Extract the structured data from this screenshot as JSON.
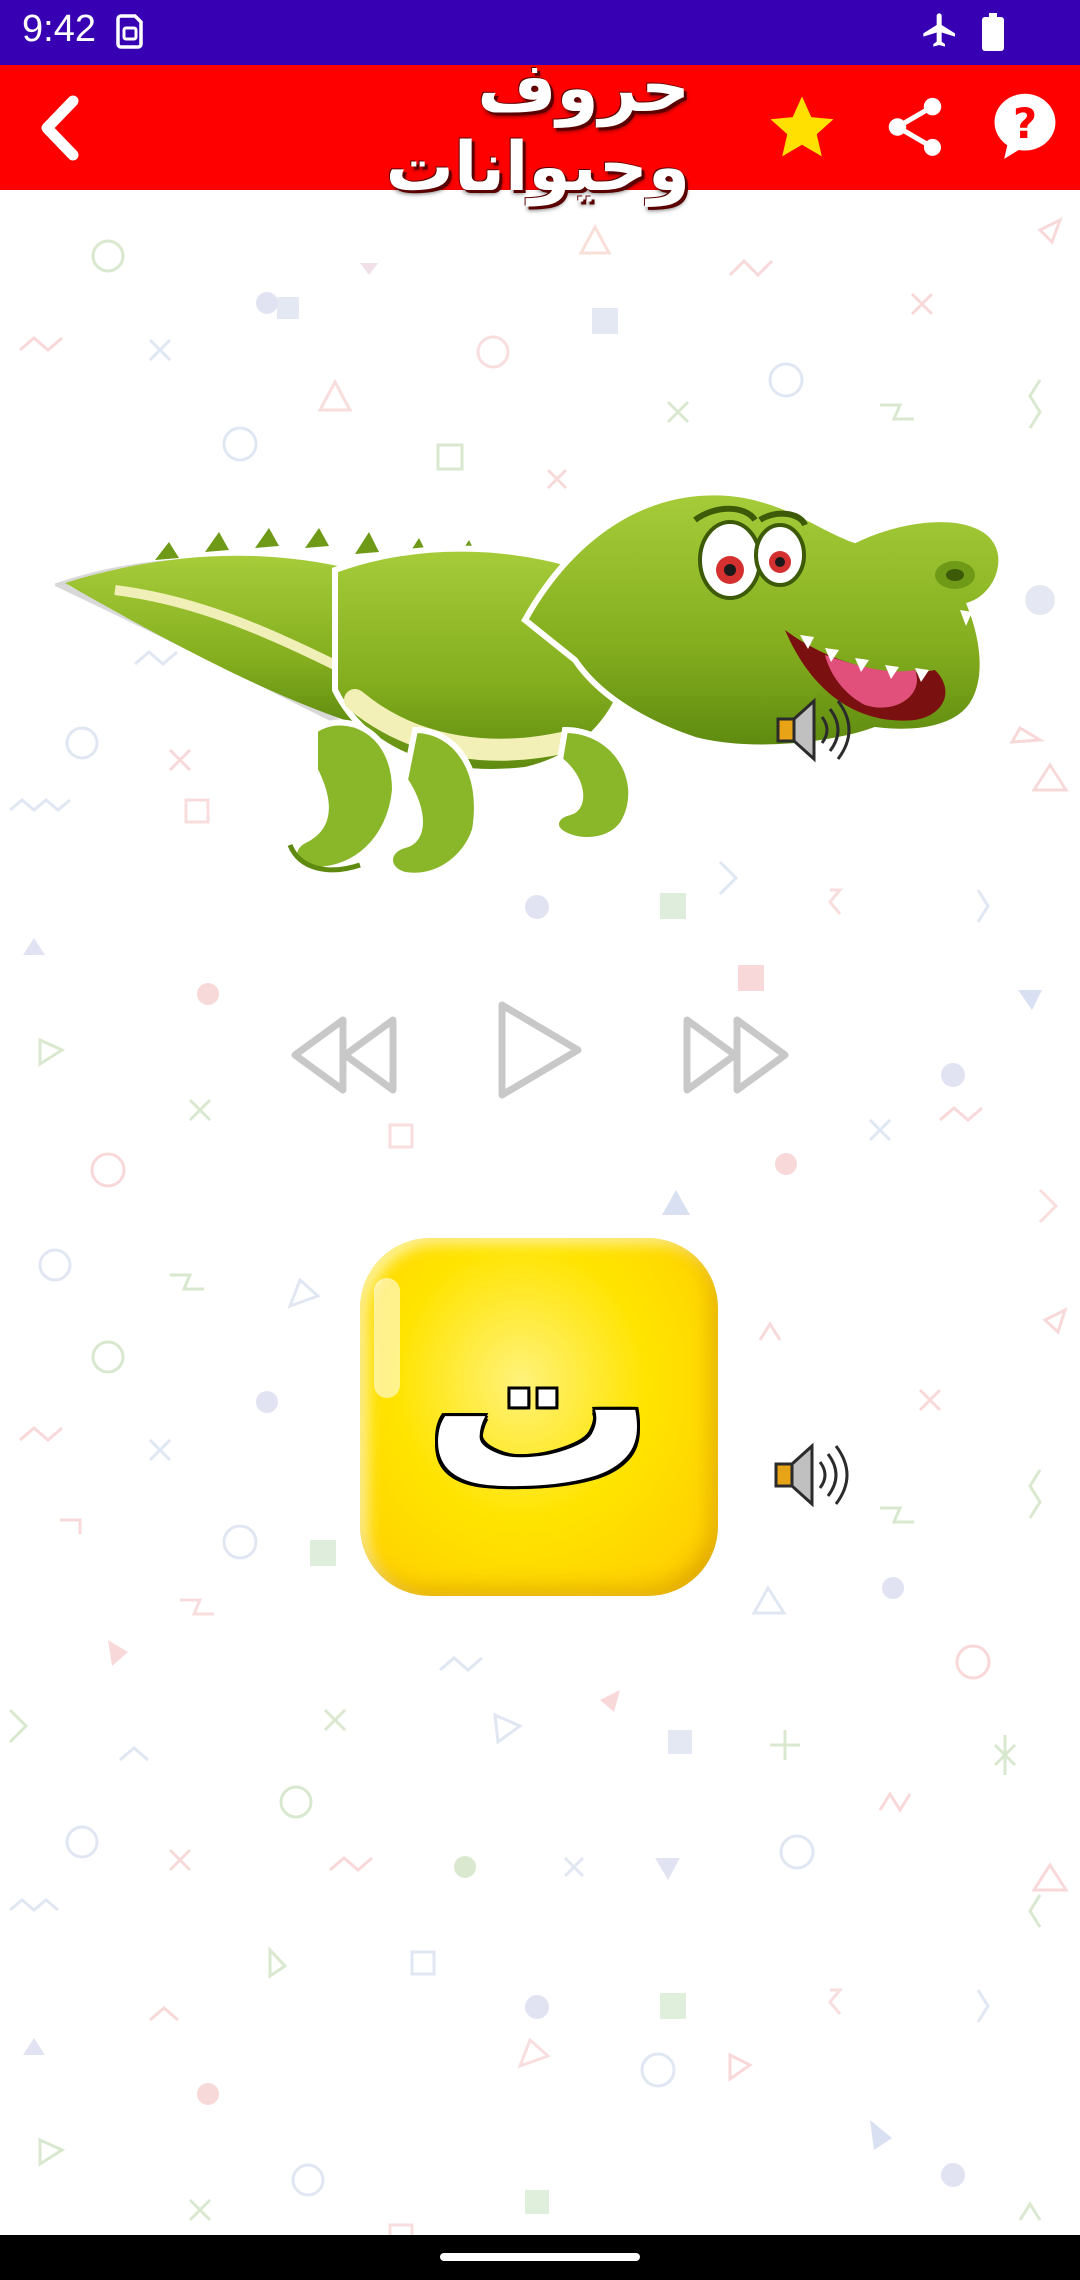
{
  "status_bar": {
    "time": "9:42",
    "icons": [
      "sim-icon",
      "airplane-mode-icon",
      "battery-icon"
    ]
  },
  "app_bar": {
    "title": "حروف وحيوانات",
    "background_color": "#ff0000",
    "actions": [
      "back-icon",
      "star-icon",
      "share-icon",
      "help-icon"
    ],
    "star_color": "#ffe000"
  },
  "lesson": {
    "animal_image": "crocodile-illustration",
    "letter": "ت",
    "tile_color": "#ffd800"
  },
  "controls": [
    "previous-icon",
    "play-icon",
    "next-icon"
  ],
  "colors": {
    "status_bar": "#3700b3",
    "nav_bar": "#000000"
  }
}
